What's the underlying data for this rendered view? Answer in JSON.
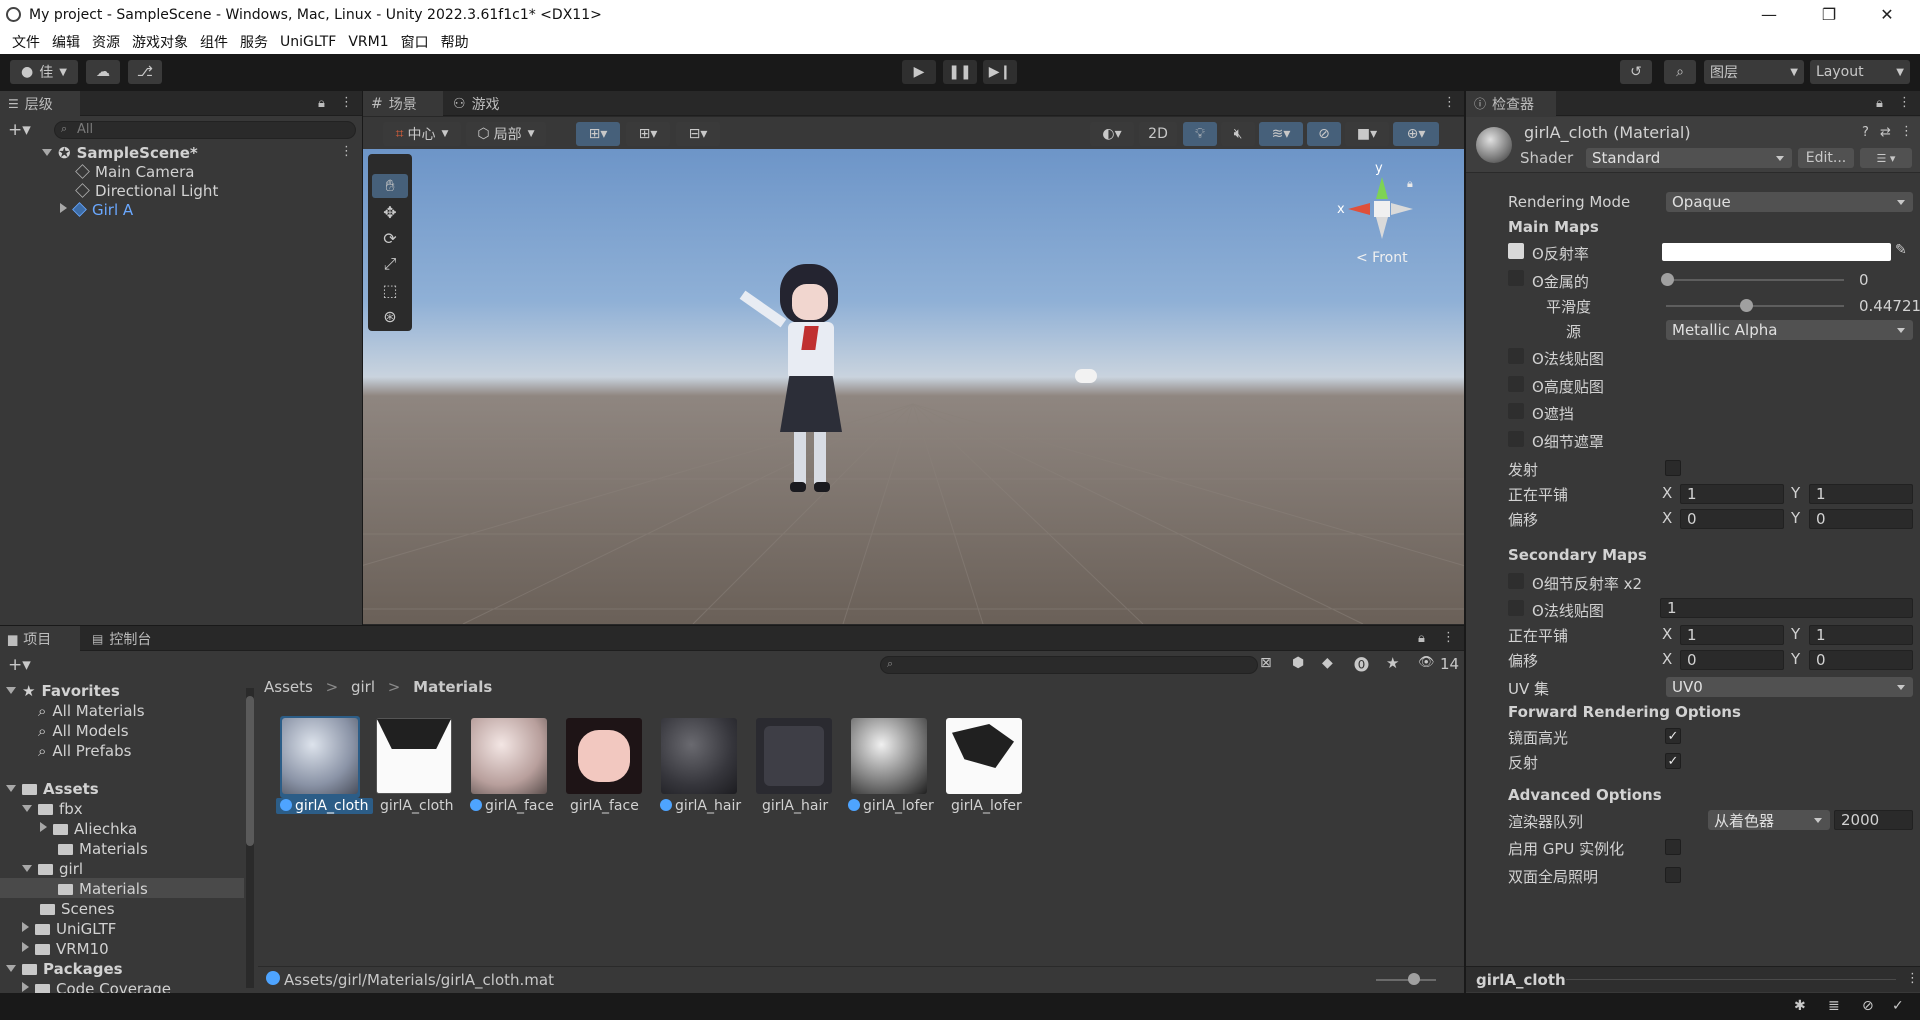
{
  "window": {
    "title": "My project - SampleScene - Windows, Mac, Linux - Unity 2022.3.61f1c1* <DX11>"
  },
  "menu": [
    "文件",
    "编辑",
    "资源",
    "游戏对象",
    "组件",
    "服务",
    "UniGLTF",
    "VRM1",
    "窗口",
    "帮助"
  ],
  "toolbar": {
    "account": "佳",
    "layers": "图层",
    "layout": "Layout"
  },
  "hierarchy": {
    "tab": "层级",
    "search_placeholder": "All",
    "scene": "SampleScene*",
    "items": [
      "Main Camera",
      "Directional Light",
      "Girl A"
    ]
  },
  "scene": {
    "tabs": [
      "场景",
      "游戏"
    ],
    "pivot": "中心",
    "space": "局部",
    "mode_2d": "2D",
    "gizmo": {
      "y": "y",
      "x": "x",
      "view": "< Front"
    }
  },
  "project": {
    "tabs": [
      "项目",
      "控制台"
    ],
    "favorites": {
      "label": "Favorites",
      "items": [
        "All Materials",
        "All Models",
        "All Prefabs"
      ]
    },
    "assets_tree": {
      "label": "Assets",
      "fbx": "fbx",
      "fbx_children": [
        "Aliechka",
        "Materials"
      ],
      "girl": "girl",
      "girl_children": [
        "Materials"
      ],
      "rest": [
        "Scenes",
        "UniGLTF",
        "VRM10"
      ]
    },
    "packages": {
      "label": "Packages",
      "items": [
        "Code Coverage"
      ]
    },
    "breadcrumb": [
      "Assets",
      "girl",
      "Materials"
    ],
    "hidden_count": "14",
    "assets": [
      {
        "name": "girlA_cloth",
        "type": "material",
        "selected": true
      },
      {
        "name": "girlA_cloth",
        "type": "texture"
      },
      {
        "name": "girlA_face",
        "type": "material"
      },
      {
        "name": "girlA_face",
        "type": "texture"
      },
      {
        "name": "girlA_hair",
        "type": "material"
      },
      {
        "name": "girlA_hair",
        "type": "texture"
      },
      {
        "name": "girlA_lofer",
        "type": "material"
      },
      {
        "name": "girlA_lofer",
        "type": "texture"
      }
    ],
    "status_path": "Assets/girl/Materials/girlA_cloth.mat"
  },
  "inspector": {
    "tab": "检查器",
    "object_name": "girlA_cloth (Material)",
    "shader_label": "Shader",
    "shader_value": "Standard",
    "edit_button": "Edit...",
    "rendering_mode_label": "Rendering Mode",
    "rendering_mode_value": "Opaque",
    "main_maps": "Main Maps",
    "albedo": "反射率",
    "metallic": "金属的",
    "metallic_value": "0",
    "smoothness": "平滑度",
    "smoothness_value": "0.44721",
    "source": "源",
    "source_value": "Metallic Alpha",
    "normal_map": "法线贴图",
    "height_map": "高度贴图",
    "occlusion": "遮挡",
    "detail_mask": "细节遮罩",
    "emission": "发射",
    "tiling": "正在平铺",
    "offset": "偏移",
    "x": "X",
    "y": "Y",
    "tiling_x": "1",
    "tiling_y": "1",
    "offset_x": "0",
    "offset_y": "0",
    "secondary_maps": "Secondary Maps",
    "detail_albedo": "细节反射率 x2",
    "sec_normal": "法线贴图",
    "sec_normal_value": "1",
    "sec_tiling_x": "1",
    "sec_tiling_y": "1",
    "sec_offset_x": "0",
    "sec_offset_y": "0",
    "uv_set": "UV 集",
    "uv_set_value": "UV0",
    "forward_options": "Forward Rendering Options",
    "specular": "镜面高光",
    "reflections": "反射",
    "advanced_options": "Advanced Options",
    "render_queue": "渲染器队列",
    "render_queue_mode": "从着色器",
    "render_queue_value": "2000",
    "gpu_instancing": "启用 GPU 实例化",
    "double_sided_gi": "双面全局照明",
    "preview_name": "girlA_cloth",
    "smoothness_fraction": 0.44721
  },
  "colors": {
    "accent": "#2c5d87",
    "bg": "#383838",
    "panel_dark": "#282828",
    "link": "#4ea4ff"
  }
}
